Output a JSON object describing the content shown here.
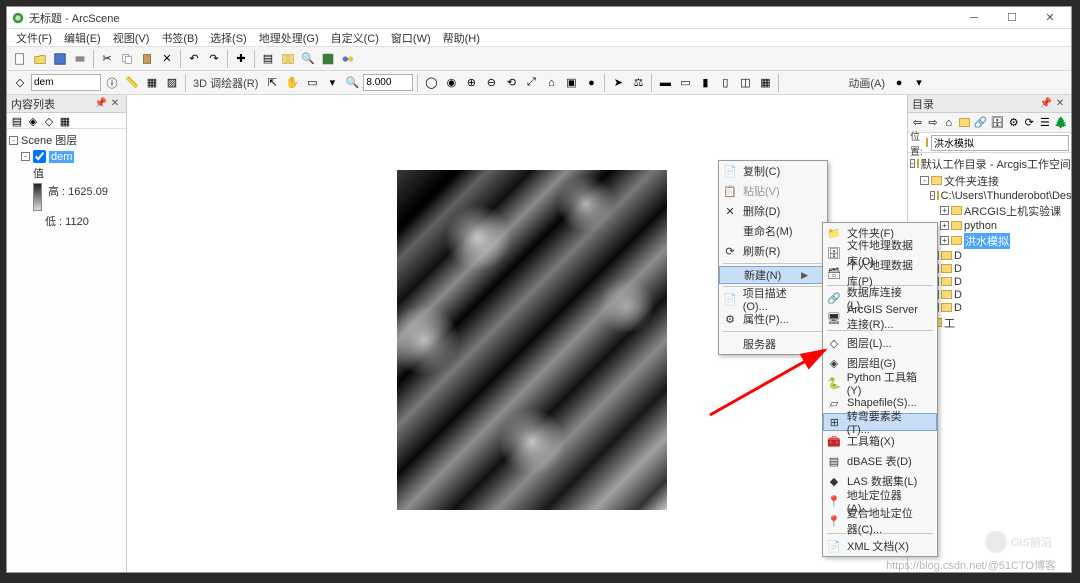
{
  "window": {
    "title": "无标题 - ArcScene"
  },
  "menubar": [
    "文件(F)",
    "编辑(E)",
    "视图(V)",
    "书签(B)",
    "选择(S)",
    "地理处理(G)",
    "自定义(C)",
    "窗口(W)",
    "帮助(H)"
  ],
  "toolbar2": {
    "layer_label": "dem",
    "mode_label": "3D 调绘器(R)",
    "zoom_value": "8.000",
    "anim_label": "动画(A)"
  },
  "toc": {
    "title": "内容列表",
    "scene": "Scene 图层",
    "layer": "dem",
    "value_label": "值",
    "high": "高 : 1625.09",
    "low": "低 : 1120"
  },
  "catalog": {
    "title": "目录",
    "loc_label": "位置:",
    "loc_value": "洪水模拟",
    "tree": {
      "root": "默认工作目录 - Arcgis工作空间",
      "folders": "文件夹连接",
      "desktop": "C:\\Users\\Thunderobot\\Desktop",
      "arcgis": "ARCGIS上机实验课",
      "python": "python",
      "selected": "洪水模拟",
      "d_rows": [
        "D",
        "D",
        "D",
        "D",
        "D",
        "工"
      ]
    }
  },
  "ctx_right": {
    "copy": "复制(C)",
    "paste": "粘贴(V)",
    "delete": "删除(D)",
    "rename": "重命名(M)",
    "refresh": "刷新(R)",
    "new": "新建(N)",
    "itemdesc": "项目描述(O)...",
    "props": "属性(P)...",
    "service": "服务器"
  },
  "ctx_new": {
    "folder": "文件夹(F)",
    "gdb": "文件地理数据库(O)",
    "pgdb": "个人地理数据库(P)",
    "dbconn": "数据库连接(L)...",
    "arcgis_server": "ArcGIS Server 连接(R)...",
    "layer": "图层(L)...",
    "grouplayer": "图层组(G)",
    "pytool": "Python 工具箱(Y)",
    "shapefile": "Shapefile(S)...",
    "dataset": "转弯要素类(T)...",
    "toolbox": "工具箱(X)",
    "dbase": "dBASE 表(D)",
    "las": "LAS 数据集(L)",
    "addressloc": "地址定位器(A)...",
    "compaddr": "复合地址定位器(C)...",
    "xml": "XML 文档(X)"
  },
  "watermark": {
    "brand": "GIS前沿",
    "url": "https://blog.csdn.net/@51CTO博客"
  }
}
